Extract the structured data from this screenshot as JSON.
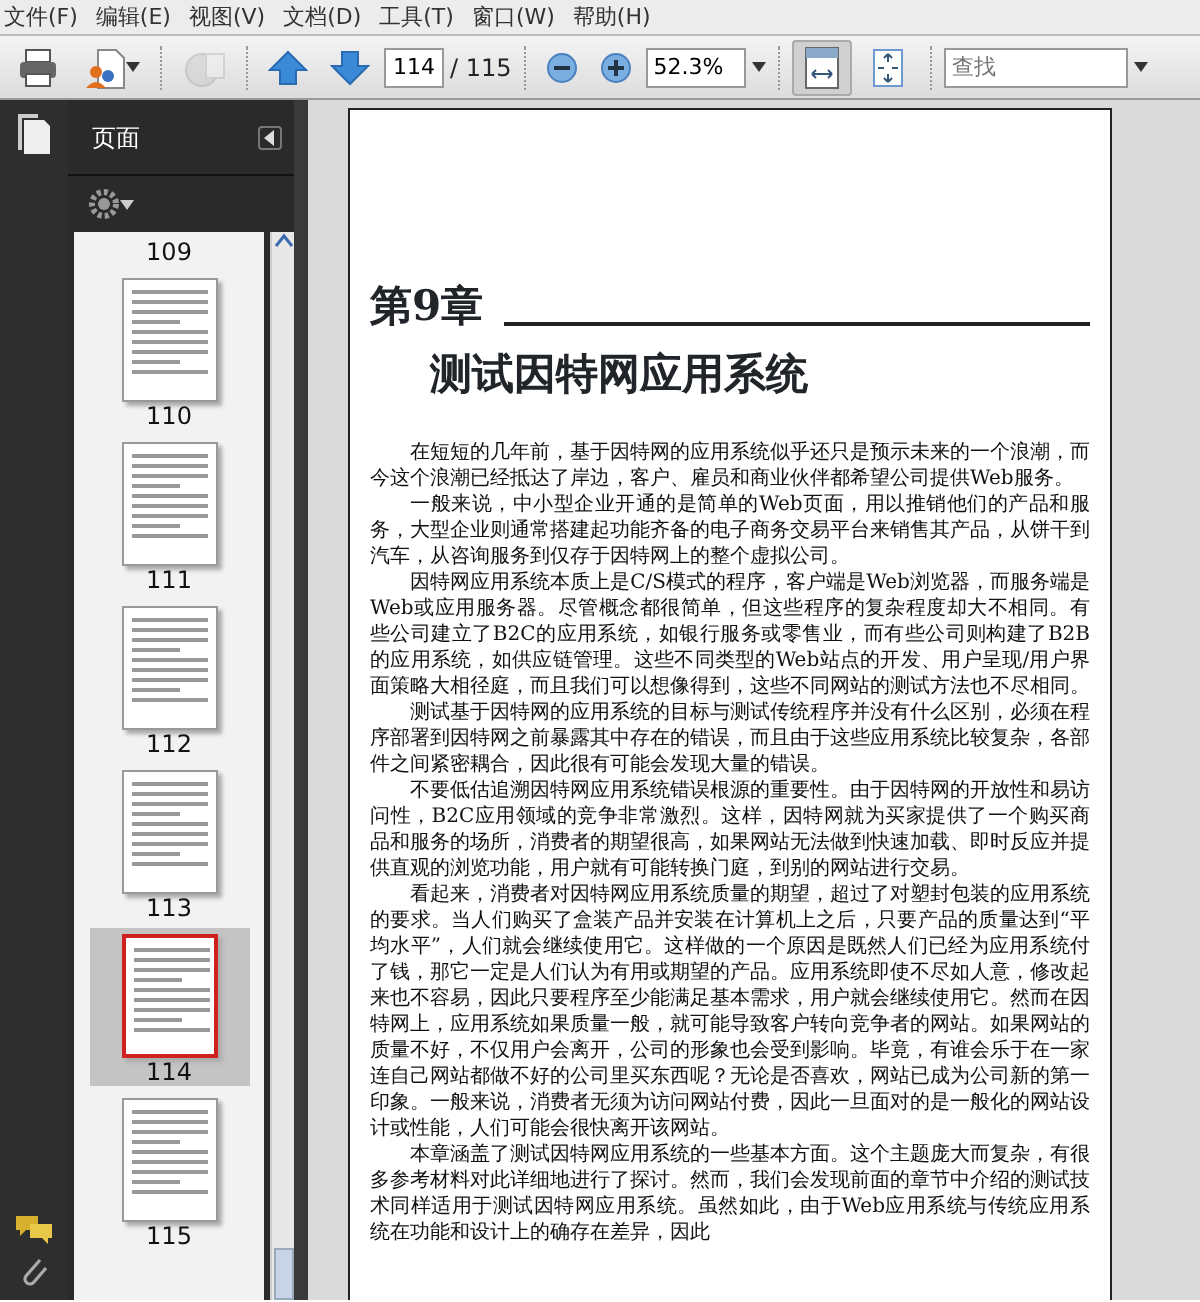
{
  "menu": [
    {
      "label": "文件(F)"
    },
    {
      "label": "编辑(E)"
    },
    {
      "label": "视图(V)"
    },
    {
      "label": "文档(D)"
    },
    {
      "label": "工具(T)"
    },
    {
      "label": "窗口(W)"
    },
    {
      "label": "帮助(H)"
    }
  ],
  "toolbar": {
    "tools": [
      {
        "kind": "print",
        "disabled": false
      },
      {
        "kind": "create",
        "disabled": false
      },
      {
        "kind": "collaborate",
        "disabled": true
      }
    ],
    "page_number": "114",
    "page_count": "/ 115",
    "zoom": "52.3%",
    "view_buttons": [
      {
        "kind": "fit-width",
        "selected": true
      },
      {
        "kind": "fit-page",
        "selected": false
      }
    ],
    "search": {
      "placeholder": "查找"
    }
  },
  "panel": {
    "title": "页面",
    "thumbnails": [
      {
        "label": "109",
        "selected": false,
        "shown": false
      },
      {
        "label": "110",
        "selected": false,
        "shown": true
      },
      {
        "label": "111",
        "selected": false,
        "shown": true
      },
      {
        "label": "112",
        "selected": false,
        "shown": true
      },
      {
        "label": "113",
        "selected": false,
        "shown": true
      },
      {
        "label": "114",
        "selected": true,
        "shown": true
      },
      {
        "label": "115",
        "selected": false,
        "shown": true
      }
    ]
  },
  "document": {
    "chapter": "第9章",
    "title": "测试因特网应用系统",
    "paragraphs": [
      "在短短的几年前，基于因特网的应用系统似乎还只是预示未来的一个浪潮，而今这个浪潮已经抵达了岸边，客户、雇员和商业伙伴都希望公司提供Web服务。",
      "一般来说，中小型企业开通的是简单的Web页面，用以推销他们的产品和服务，大型企业则通常搭建起功能齐备的电子商务交易平台来销售其产品，从饼干到汽车，从咨询服务到仅存于因特网上的整个虚拟公司。",
      "因特网应用系统本质上是C/S模式的程序，客户端是Web浏览器，而服务端是Web或应用服务器。尽管概念都很简单，但这些程序的复杂程度却大不相同。有些公司建立了B2C的应用系统，如银行服务或零售业，而有些公司则构建了B2B的应用系统，如供应链管理。这些不同类型的Web站点的开发、用户呈现/用户界面策略大相径庭，而且我们可以想像得到，这些不同网站的测试方法也不尽相同。",
      "测试基于因特网的应用系统的目标与测试传统程序并没有什么区别，必须在程序部署到因特网之前暴露其中存在的错误，而且由于这些应用系统比较复杂，各部件之间紧密耦合，因此很有可能会发现大量的错误。",
      "不要低估追溯因特网应用系统错误根源的重要性。由于因特网的开放性和易访问性，B2C应用领域的竞争非常激烈。这样，因特网就为买家提供了一个购买商品和服务的场所，消费者的期望很高，如果网站无法做到快速加载、即时反应并提供直观的浏览功能，用户就有可能转换门庭，到别的网站进行交易。",
      "看起来，消费者对因特网应用系统质量的期望，超过了对塑封包装的应用系统的要求。当人们购买了盒装产品并安装在计算机上之后，只要产品的质量达到“平均水平”，人们就会继续使用它。这样做的一个原因是既然人们已经为应用系统付了钱，那它一定是人们认为有用或期望的产品。应用系统即使不尽如人意，修改起来也不容易，因此只要程序至少能满足基本需求，用户就会继续使用它。然而在因特网上，应用系统如果质量一般，就可能导致客户转向竞争者的网站。如果网站的质量不好，不仅用户会离开，公司的形象也会受到影响。毕竟，有谁会乐于在一家连自己网站都做不好的公司里买东西呢？无论是否喜欢，网站已成为公司新的第一印象。一般来说，消费者无须为访问网站付费，因此一旦面对的是一般化的网站设计或性能，人们可能会很快离开该网站。",
      "本章涵盖了测试因特网应用系统的一些基本方面。这个主题庞大而复杂，有很多参考材料对此详细地进行了探讨。然而，我们会发现前面的章节中介绍的测试技术同样适用于测试因特网应用系统。虽然如此，由于Web应用系统与传统应用系统在功能和设计上的确存在差异，因此"
    ]
  }
}
